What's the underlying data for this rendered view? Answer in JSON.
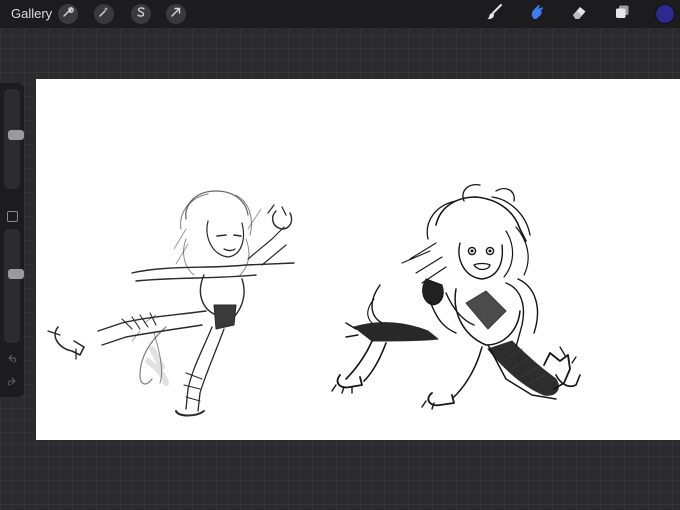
{
  "topbar": {
    "gallery_label": "Gallery",
    "left_tools": [
      {
        "name": "actions",
        "icon": "wrench-icon"
      },
      {
        "name": "adjustments",
        "icon": "magic-wand-icon"
      },
      {
        "name": "selection",
        "icon": "selection-s-icon"
      },
      {
        "name": "transform",
        "icon": "arrow-cursor-icon"
      }
    ],
    "right_tools": [
      {
        "name": "brush",
        "icon": "brush-icon",
        "active": false
      },
      {
        "name": "smudge",
        "icon": "smudge-finger-icon",
        "active": true
      },
      {
        "name": "eraser",
        "icon": "eraser-icon",
        "active": false
      },
      {
        "name": "layers",
        "icon": "layers-icon",
        "active": false
      }
    ],
    "current_color": "#2c2a8f",
    "active_tool_color": "#3c7cf6"
  },
  "sidebar": {
    "brush_size_level": 0.55,
    "opacity_level": 0.62,
    "icons": [
      "modify-square-icon",
      "undo-arrow-icon",
      "redo-arrow-icon"
    ]
  },
  "canvas": {
    "background": "#ffffff",
    "content": "sketch"
  }
}
